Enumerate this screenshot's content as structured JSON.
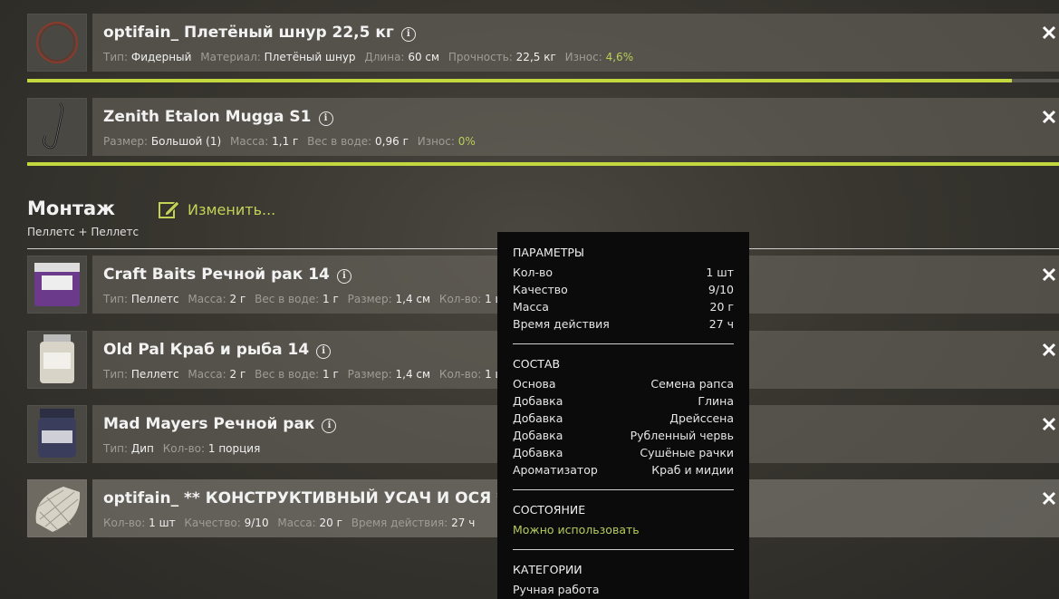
{
  "line": {
    "title": "optifain_ Плетёный шнур 22,5 кг",
    "type_label": "Тип:",
    "type_value": "Фидерный",
    "material_label": "Материал:",
    "material_value": "Плетёный шнур",
    "length_label": "Длина:",
    "length_value": "60 см",
    "strength_label": "Прочность:",
    "strength_value": "22,5 кг",
    "wear_label": "Износ:",
    "wear_value": "4,6%",
    "condition_fraction": 0.954
  },
  "hook": {
    "title": "Zenith Etalon Mugga S1",
    "size_label": "Размер:",
    "size_value": "Большой (1)",
    "mass_label": "Масса:",
    "mass_value": "1,1 г",
    "water_label": "Вес в воде:",
    "water_value": "0,96 г",
    "wear_label": "Износ:",
    "wear_value": "0%",
    "condition_fraction": 1.0
  },
  "rig": {
    "title": "Монтаж",
    "subtitle": "Пеллетс + Пеллетс",
    "edit_label": "Изменить..."
  },
  "baits": [
    {
      "title": "Craft Baits Речной рак 14",
      "meta": [
        [
          "Тип:",
          "Пеллетс"
        ],
        [
          "Масса:",
          "2 г"
        ],
        [
          "Вес в воде:",
          "1 г"
        ],
        [
          "Размер:",
          "1,4 см"
        ],
        [
          "Кол-во:",
          "1 шт"
        ]
      ]
    },
    {
      "title": "Old Pal Краб и рыба 14",
      "meta": [
        [
          "Тип:",
          "Пеллетс"
        ],
        [
          "Масса:",
          "2 г"
        ],
        [
          "Вес в воде:",
          "1 г"
        ],
        [
          "Размер:",
          "1,4 см"
        ],
        [
          "Кол-во:",
          "1 шт"
        ]
      ]
    },
    {
      "title": "Mad Mayers Речной рак",
      "meta": [
        [
          "Тип:",
          "Дип"
        ],
        [
          "Кол-во:",
          "1 порция"
        ]
      ]
    },
    {
      "title": "optifain_ ** КОНСТРУКТИВНЫЙ УСАЧ И ОСЯ **",
      "meta": [
        [
          "Кол-во:",
          "1 шт"
        ],
        [
          "Качество:",
          "9/10"
        ],
        [
          "Масса:",
          "20 г"
        ],
        [
          "Время действия:",
          "27 ч"
        ]
      ]
    }
  ],
  "tooltip": {
    "params_header": "ПАРАМЕТРЫ",
    "params": [
      [
        "Кол-во",
        "1 шт"
      ],
      [
        "Качество",
        "9/10"
      ],
      [
        "Масса",
        "20 г"
      ],
      [
        "Время действия",
        "27 ч"
      ]
    ],
    "composition_header": "СОСТАВ",
    "composition": [
      [
        "Основа",
        "Семена рапса"
      ],
      [
        "Добавка",
        "Глина"
      ],
      [
        "Добавка",
        "Дрейссена"
      ],
      [
        "Добавка",
        "Рубленный червь"
      ],
      [
        "Добавка",
        "Сушёные рачки"
      ],
      [
        "Ароматизатор",
        "Краб и мидии"
      ]
    ],
    "state_header": "СОСТОЯНИЕ",
    "state_value": "Можно использовать",
    "categories_header": "КАТЕГОРИИ",
    "category_value": "Ручная работа"
  },
  "colors": {
    "accent": "#c3d83e",
    "positive": "#b5cc5c"
  }
}
